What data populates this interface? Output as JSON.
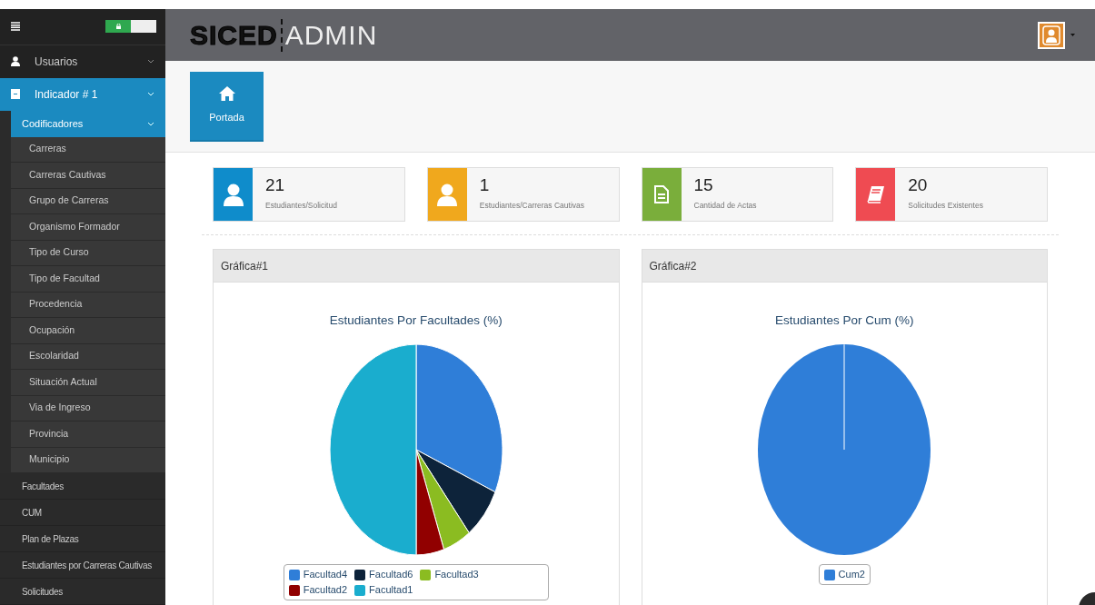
{
  "header": {
    "logo_left": "SICED",
    "logo_right": "ADMIN"
  },
  "sidebar": {
    "items": [
      {
        "label": "Usuarios",
        "kind": "user",
        "selected": false,
        "expanded": false
      },
      {
        "label": "Indicador # 1",
        "kind": "box",
        "selected": true,
        "expanded": true,
        "children": [
          {
            "label": "Codificadores",
            "kind": "group",
            "selected": true,
            "expanded": true,
            "children": [
              {
                "label": "Carreras"
              },
              {
                "label": "Carreras Cautivas"
              },
              {
                "label": "Grupo de Carreras"
              },
              {
                "label": "Organismo Formador"
              },
              {
                "label": "Tipo de Curso"
              },
              {
                "label": "Tipo de Facultad"
              },
              {
                "label": "Procedencia"
              },
              {
                "label": "Ocupación"
              },
              {
                "label": "Escolaridad"
              },
              {
                "label": "Situación Actual"
              },
              {
                "label": "Via de Ingreso"
              },
              {
                "label": "Provincia"
              },
              {
                "label": "Municipio"
              }
            ]
          },
          {
            "label": "Facultades",
            "kind": "link"
          },
          {
            "label": "CUM",
            "kind": "link"
          },
          {
            "label": "Plan de Plazas",
            "kind": "link"
          },
          {
            "label": "Estudiantes por Carreras Cautivas",
            "kind": "link"
          },
          {
            "label": "Solicitudes",
            "kind": "link"
          }
        ]
      }
    ]
  },
  "shortcut": {
    "label": "Portada"
  },
  "stats": [
    {
      "value": "21",
      "label": "Estudiantes/Solicitud",
      "color": "#0f8ccb",
      "kind": "user"
    },
    {
      "value": "1",
      "label": "Estudiantes/Carreras Cautivas",
      "color": "#f0a81d",
      "kind": "user"
    },
    {
      "value": "15",
      "label": "Cantidad de Actas",
      "color": "#7aae3b",
      "kind": "document"
    },
    {
      "value": "20",
      "label": "Solicitudes Existentes",
      "color": "#ef4b52",
      "kind": "book"
    }
  ],
  "panels": [
    {
      "title": "Gráfica#1",
      "chart_title": "Estudiantes Por Facultades (%)",
      "legend": [
        {
          "name": "Facultad4",
          "color": "#2f7ed8"
        },
        {
          "name": "Facultad6",
          "color": "#0d233a"
        },
        {
          "name": "Facultad3",
          "color": "#8bbc21"
        },
        {
          "name": "Facultad2",
          "color": "#910000"
        },
        {
          "name": "Facultad1",
          "color": "#1aadce"
        }
      ]
    },
    {
      "title": "Gráfica#2",
      "chart_title": "Estudiantes Por Cum (%)",
      "legend": [
        {
          "name": "Cum2",
          "color": "#2f7ed8"
        }
      ]
    }
  ]
}
